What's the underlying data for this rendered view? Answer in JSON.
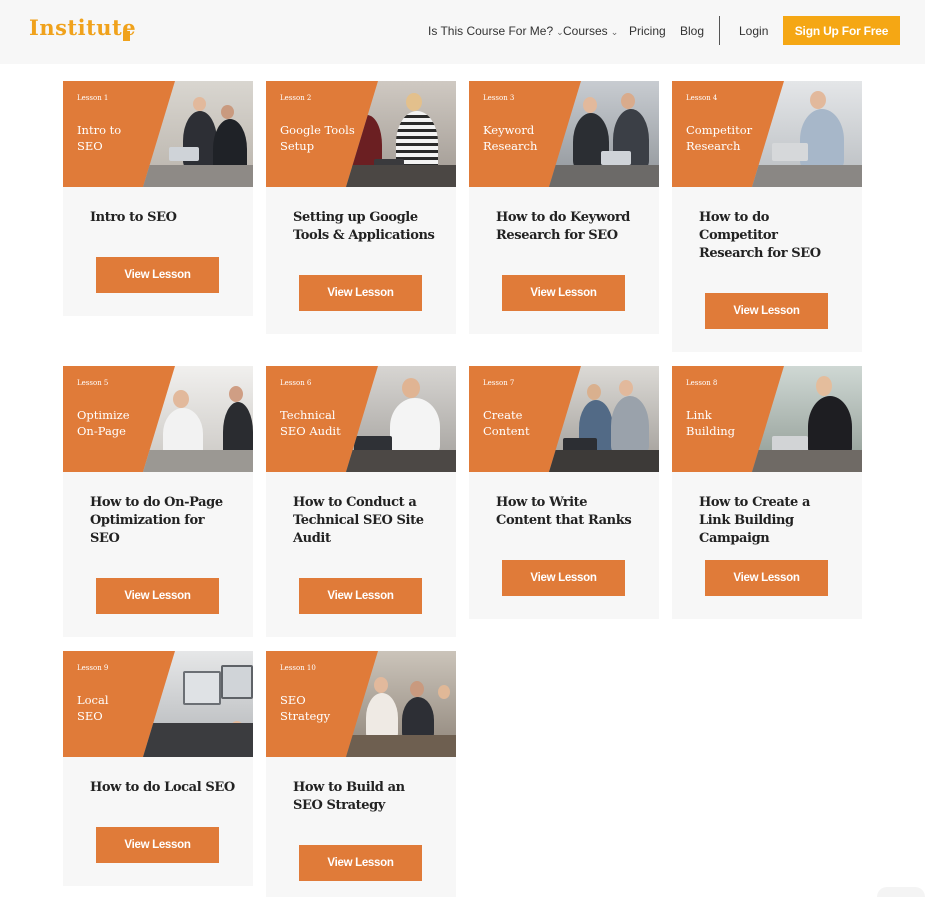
{
  "header": {
    "logo": "Institute",
    "nav": [
      {
        "label": "Is This Course For Me?",
        "dropdown": true
      },
      {
        "label": "Courses",
        "dropdown": true
      },
      {
        "label": "Pricing",
        "dropdown": false
      },
      {
        "label": "Blog",
        "dropdown": false
      }
    ],
    "login": "Login",
    "signup": "Sign Up For Free"
  },
  "colors": {
    "accent": "#e07b39",
    "brand": "#f0a21c",
    "button": "#f5a714",
    "card_bg": "#f7f7f7"
  },
  "lessons": [
    {
      "num": "Lesson 1",
      "banner_line1": "Intro to",
      "banner_line2": "SEO",
      "title": "Intro to SEO",
      "button": "View Lesson"
    },
    {
      "num": "Lesson 2",
      "banner_line1": "Google Tools",
      "banner_line2": "Setup",
      "title": "Setting up Google Tools & Applications",
      "button": "View Lesson"
    },
    {
      "num": "Lesson 3",
      "banner_line1": "Keyword",
      "banner_line2": "Research",
      "title": "How to do Keyword Research for SEO",
      "button": "View Lesson"
    },
    {
      "num": "Lesson 4",
      "banner_line1": "Competitor",
      "banner_line2": "Research",
      "title": "How to do Competitor Research for SEO",
      "button": "View Lesson"
    },
    {
      "num": "Lesson 5",
      "banner_line1": "Optimize",
      "banner_line2": "On-Page",
      "title": "How to do On-Page Optimization for SEO",
      "button": "View Lesson"
    },
    {
      "num": "Lesson 6",
      "banner_line1": "Technical",
      "banner_line2": "SEO Audit",
      "title": "How to Conduct a Technical SEO Site Audit",
      "button": "View Lesson"
    },
    {
      "num": "Lesson 7",
      "banner_line1": "Create",
      "banner_line2": "Content",
      "title": "How to Write Content that Ranks",
      "button": "View Lesson"
    },
    {
      "num": "Lesson 8",
      "banner_line1": "Link",
      "banner_line2": "Building",
      "title": "How to Create a Link Building Campaign",
      "button": "View Lesson"
    },
    {
      "num": "Lesson 9",
      "banner_line1": "Local",
      "banner_line2": "SEO",
      "title": "How to do Local SEO",
      "button": "View Lesson"
    },
    {
      "num": "Lesson 10",
      "banner_line1": "SEO",
      "banner_line2": "Strategy",
      "title": "How to Build an SEO Strategy",
      "button": "View Lesson"
    }
  ]
}
